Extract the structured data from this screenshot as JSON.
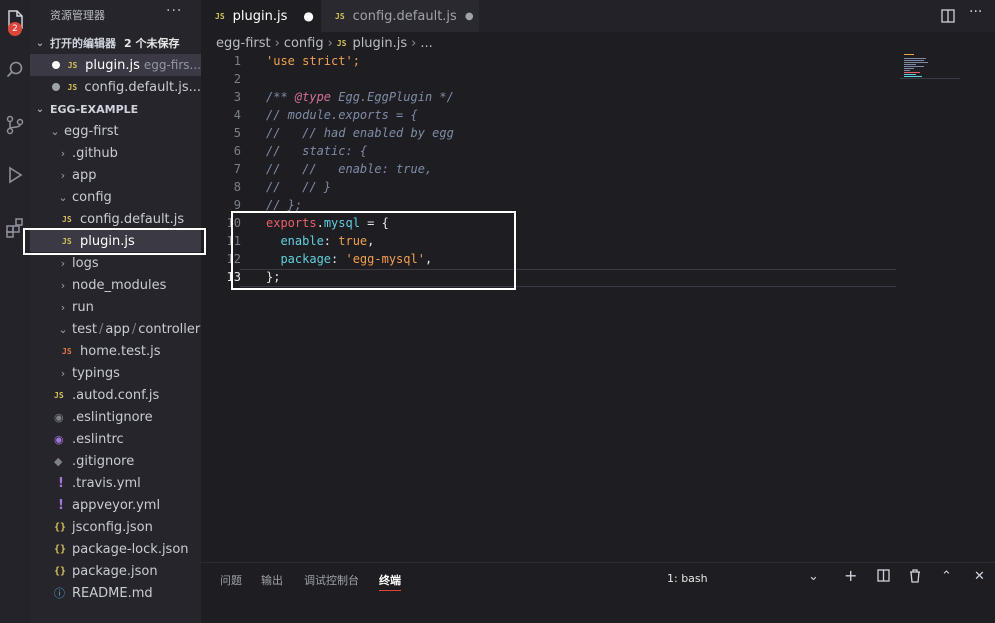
{
  "activity": {
    "badge": "2"
  },
  "sidebar": {
    "title": "资源管理器",
    "more": "···",
    "open_editors": {
      "header": "打开的编辑器",
      "dirty_count": "2 个未保存",
      "items": [
        {
          "name": "plugin.js",
          "hint": "egg-firs..."
        },
        {
          "name": "config.default.js...",
          "hint": ""
        }
      ]
    },
    "project": {
      "header": "EGG-EXAMPLE",
      "tree": [
        {
          "label": "egg-first"
        },
        {
          "label": ".github"
        },
        {
          "label": "app"
        },
        {
          "label": "config"
        },
        {
          "label": "config.default.js"
        },
        {
          "label": "plugin.js"
        },
        {
          "label": "logs"
        },
        {
          "label": "node_modules"
        },
        {
          "label": "run"
        },
        {
          "label_parts": [
            "test",
            "app",
            "controller"
          ]
        },
        {
          "label": "home.test.js"
        },
        {
          "label": "typings"
        },
        {
          "label": ".autod.conf.js"
        },
        {
          "label": ".eslintignore"
        },
        {
          "label": ".eslintrc"
        },
        {
          "label": ".gitignore"
        },
        {
          "label": ".travis.yml"
        },
        {
          "label": "appveyor.yml"
        },
        {
          "label": "jsconfig.json"
        },
        {
          "label": "package-lock.json"
        },
        {
          "label": "package.json"
        },
        {
          "label": "README.md"
        }
      ]
    }
  },
  "tabs": [
    {
      "label": "plugin.js",
      "icon": "JS"
    },
    {
      "label": "config.default.js",
      "icon": "JS"
    }
  ],
  "breadcrumb": {
    "parts": [
      "egg-first",
      "config",
      "plugin.js",
      "..."
    ]
  },
  "code": {
    "line_numbers": [
      "1",
      "2",
      "3",
      "4",
      "5",
      "6",
      "7",
      "8",
      "9",
      "10",
      "11",
      "12",
      "13"
    ],
    "lines": {
      "l1": "'use strict';",
      "l3a": "/** ",
      "l3b": "@type",
      "l3c": " Egg.EggPlugin */",
      "l4": "// module.exports = {",
      "l5": "//   // had enabled by egg",
      "l6": "//   static: {",
      "l7": "//   //   enable: true,",
      "l8": "//   // }",
      "l9": "// };",
      "l10a": "exports",
      "l10b": ".",
      "l10c": "mysql",
      "l10d": " = {",
      "l11a": "  enable",
      "l11b": ": ",
      "l11c": "true",
      "l11d": ",",
      "l12a": "  package",
      "l12b": ": ",
      "l12c": "'egg-mysql'",
      "l12d": ",",
      "l13": "};"
    }
  },
  "panel": {
    "tabs": [
      "问题",
      "输出",
      "调试控制台",
      "终端"
    ],
    "terminal_select": "1: bash"
  },
  "colors": {
    "accent_badge": "#e0453c",
    "js_icon": "#d4c255",
    "highlight_border": "#ffffff"
  }
}
